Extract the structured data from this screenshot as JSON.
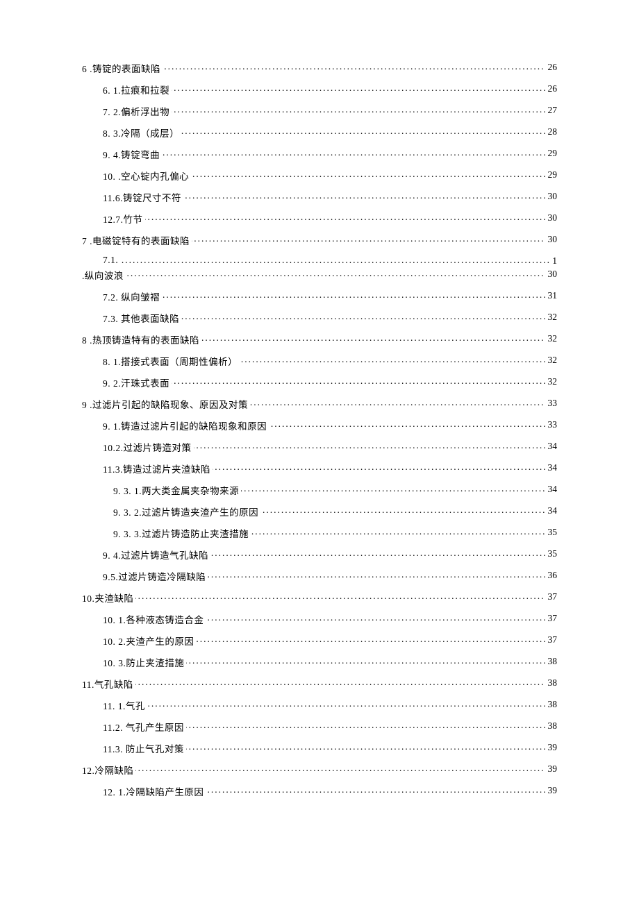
{
  "toc": [
    {
      "lvl": 1,
      "num": "6",
      "sep": "  .",
      "title": "铸锭的表面缺陷",
      "page": "26"
    },
    {
      "lvl": 2,
      "num": "6.",
      "sep": "  ",
      "title": "1.拉痕和拉裂",
      "page": "26"
    },
    {
      "lvl": 2,
      "num": "7.",
      "sep": "  ",
      "title": "2.偏析浮出物",
      "page": "27"
    },
    {
      "lvl": 2,
      "num": "8.",
      "sep": "  ",
      "title": "3.冷隔（成层）",
      "page": "28"
    },
    {
      "lvl": 2,
      "num": "9.",
      "sep": "  ",
      "title": "4.铸锭弯曲",
      "page": "29"
    },
    {
      "lvl": 2,
      "num": "10.",
      "sep": "   .",
      "title": "空心锭内孔偏心",
      "page": "29"
    },
    {
      "lvl": 2,
      "num": "11.",
      "sep": "",
      "title": "6.铸锭尺寸不符",
      "page": "30"
    },
    {
      "lvl": 2,
      "num": "12.",
      "sep": "",
      "title": "7.竹节",
      "page": "30"
    },
    {
      "lvl": 1,
      "num": "7",
      "sep": "  .",
      "title": "电磁锭特有的表面缺陷",
      "page": "30"
    },
    {
      "lvl": 2,
      "wrapA": {
        "num": "7.1.",
        "page": "1"
      },
      "wrapB": {
        "num": ".",
        "title": "纵向波浪",
        "page": "30"
      }
    },
    {
      "lvl": 2,
      "num": "7.2.",
      "sep": "   ",
      "title": "纵向皱褶",
      "page": "31"
    },
    {
      "lvl": 2,
      "num": "7.3.",
      "sep": "   ",
      "title": "其他表面缺陷",
      "page": "32"
    },
    {
      "lvl": 1,
      "num": "8",
      "sep": "  .",
      "title": "热顶铸造特有的表面缺陷",
      "page": "32"
    },
    {
      "lvl": 2,
      "num": "8.",
      "sep": "  ",
      "title": "1.搭接式表面（周期性偏析）",
      "page": "32"
    },
    {
      "lvl": 2,
      "num": "9.",
      "sep": "  ",
      "title": "2.汗珠式表面",
      "page": "32"
    },
    {
      "lvl": 1,
      "num": "9",
      "sep": "   .",
      "title": "过滤片引起的缺陷现象、原因及对策",
      "page": "33"
    },
    {
      "lvl": 2,
      "num": "9.",
      "sep": "  ",
      "title": "1.铸造过滤片引起的缺陷现象和原因",
      "page": "33"
    },
    {
      "lvl": 2,
      "num": "10.",
      "sep": "",
      "title": "2.过滤片铸造对策",
      "page": "34"
    },
    {
      "lvl": 2,
      "num": "11.",
      "sep": "",
      "title": "3.铸造过滤片夹渣缺陷",
      "page": "34"
    },
    {
      "lvl": 3,
      "num": "9.",
      "sep": "  ",
      "title": "3.  1.两大类金属夹杂物来源",
      "page": "34"
    },
    {
      "lvl": 3,
      "num": "9.",
      "sep": "  ",
      "title": "3.  2.过滤片铸造夹渣产生的原因",
      "page": "34"
    },
    {
      "lvl": 3,
      "num": "9.",
      "sep": "  ",
      "title": "3.  3.过滤片铸造防止夹渣措施",
      "page": "35"
    },
    {
      "lvl": 2,
      "num": "9.",
      "sep": "  ",
      "title": "4.过滤片铸造气孔缺陷",
      "page": "35"
    },
    {
      "lvl": 2,
      "num": "9.5.",
      "sep": "",
      "title": "过滤片铸造冷隔缺陷",
      "page": "36"
    },
    {
      "lvl": 1,
      "num": "10.",
      "sep": "",
      "title": "夹渣缺陷",
      "page": "37"
    },
    {
      "lvl": 2,
      "num": "10.",
      "sep": "  ",
      "title": "1.各种液态铸造合金",
      "page": "37"
    },
    {
      "lvl": 2,
      "num": "10.",
      "sep": "  ",
      "title": "2.夹渣产生的原因",
      "page": "37"
    },
    {
      "lvl": 2,
      "num": "10.",
      "sep": "  ",
      "title": "3.防止夹渣措施",
      "page": "38"
    },
    {
      "lvl": 1,
      "num": "11.",
      "sep": "",
      "title": "气孔缺陷",
      "page": "38"
    },
    {
      "lvl": 2,
      "num": "11.",
      "sep": "  ",
      "title": "1.气孔",
      "page": "38"
    },
    {
      "lvl": 2,
      "num": "11.2.",
      "sep": "   ",
      "title": "气孔产生原因",
      "page": "38"
    },
    {
      "lvl": 2,
      "num": "11.3.",
      "sep": "   ",
      "title": "防止气孔对策",
      "page": "39"
    },
    {
      "lvl": 1,
      "num": "12.",
      "sep": "",
      "title": "冷隔缺陷",
      "page": "39"
    },
    {
      "lvl": 2,
      "num": "12.",
      "sep": "  ",
      "title": "1.冷隔缺陷产生原因",
      "page": "39"
    }
  ]
}
